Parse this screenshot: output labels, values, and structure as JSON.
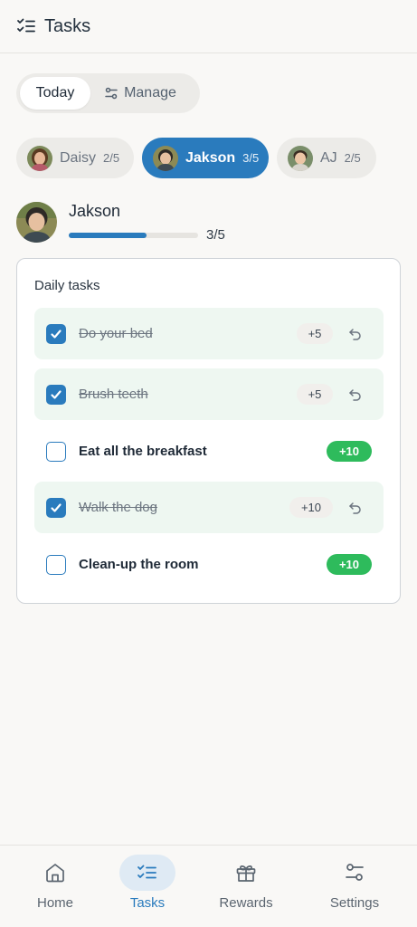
{
  "header": {
    "title": "Tasks",
    "icon": "checklist-icon"
  },
  "segment": {
    "today_label": "Today",
    "manage_label": "Manage"
  },
  "kids": [
    {
      "name": "Daisy",
      "count": "2/5",
      "active": false
    },
    {
      "name": "Jakson",
      "count": "3/5",
      "active": true
    },
    {
      "name": "AJ",
      "count": "2/5",
      "active": false
    }
  ],
  "current": {
    "name": "Jakson",
    "progress_text": "3/5",
    "progress_fraction": 0.6
  },
  "card": {
    "title": "Daily tasks",
    "tasks": [
      {
        "label": "Do your bed",
        "points": "+5",
        "done": true
      },
      {
        "label": "Brush teeth",
        "points": "+5",
        "done": true
      },
      {
        "label": "Eat all the breakfast",
        "points": "+10",
        "done": false
      },
      {
        "label": "Walk the dog",
        "points": "+10",
        "done": true
      },
      {
        "label": "Clean-up the room",
        "points": "+10",
        "done": false
      }
    ]
  },
  "nav": [
    {
      "label": "Home",
      "icon": "home-icon",
      "active": false
    },
    {
      "label": "Tasks",
      "icon": "checklist-icon",
      "active": true
    },
    {
      "label": "Rewards",
      "icon": "gift-icon",
      "active": false
    },
    {
      "label": "Settings",
      "icon": "sliders-icon",
      "active": false
    }
  ],
  "colors": {
    "accent": "#2a7bbd",
    "green": "#2ebb5c",
    "done_bg": "#eef7f1"
  }
}
